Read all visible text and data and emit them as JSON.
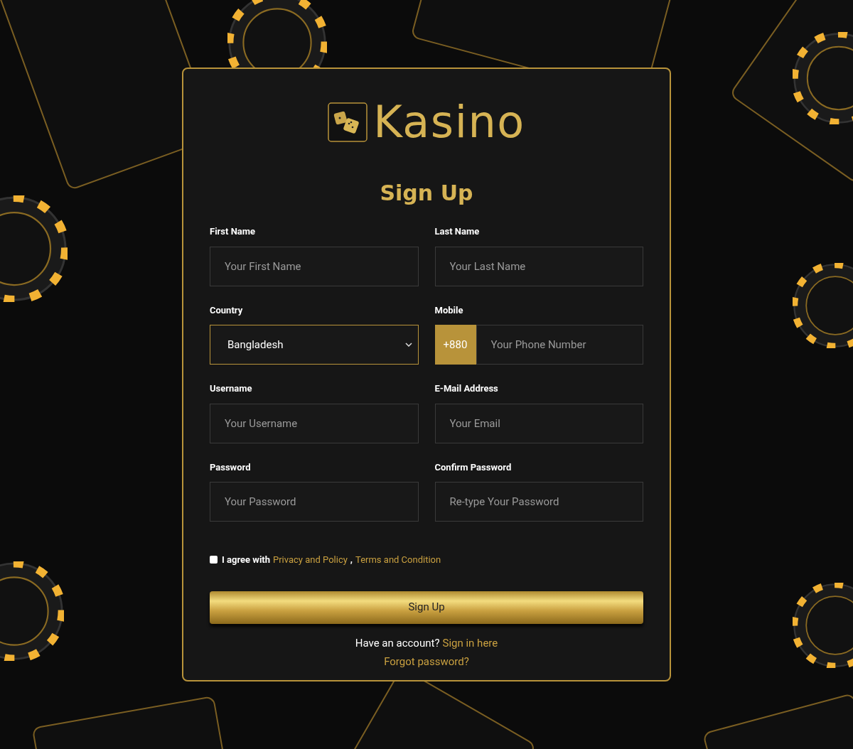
{
  "brand": {
    "name": "Kasino"
  },
  "heading": "Sign Up",
  "fields": [
    {
      "kind": "text",
      "label": "First Name",
      "placeholder": "Your First Name"
    },
    {
      "kind": "text",
      "label": "Last Name",
      "placeholder": "Your Last Name"
    },
    {
      "kind": "select",
      "label": "Country",
      "value": "Bangladesh"
    },
    {
      "kind": "phone",
      "label": "Mobile",
      "prefix": "+880",
      "placeholder": "Your Phone Number"
    },
    {
      "kind": "text",
      "label": "Username",
      "placeholder": "Your Username"
    },
    {
      "kind": "text",
      "label": "E-Mail Address",
      "placeholder": "Your Email"
    },
    {
      "kind": "text",
      "label": "Password",
      "placeholder": "Your Password"
    },
    {
      "kind": "text",
      "label": "Confirm Password",
      "placeholder": "Re-type Your Password"
    }
  ],
  "agreement": {
    "checked": false,
    "text": "I agree with",
    "links": [
      "Privacy and Policy",
      "Terms and Condition"
    ],
    "separator": ","
  },
  "submit": "Sign Up",
  "signin": {
    "text": "Have an account?",
    "link": "Sign in here"
  },
  "forgot": "Forgot password?"
}
